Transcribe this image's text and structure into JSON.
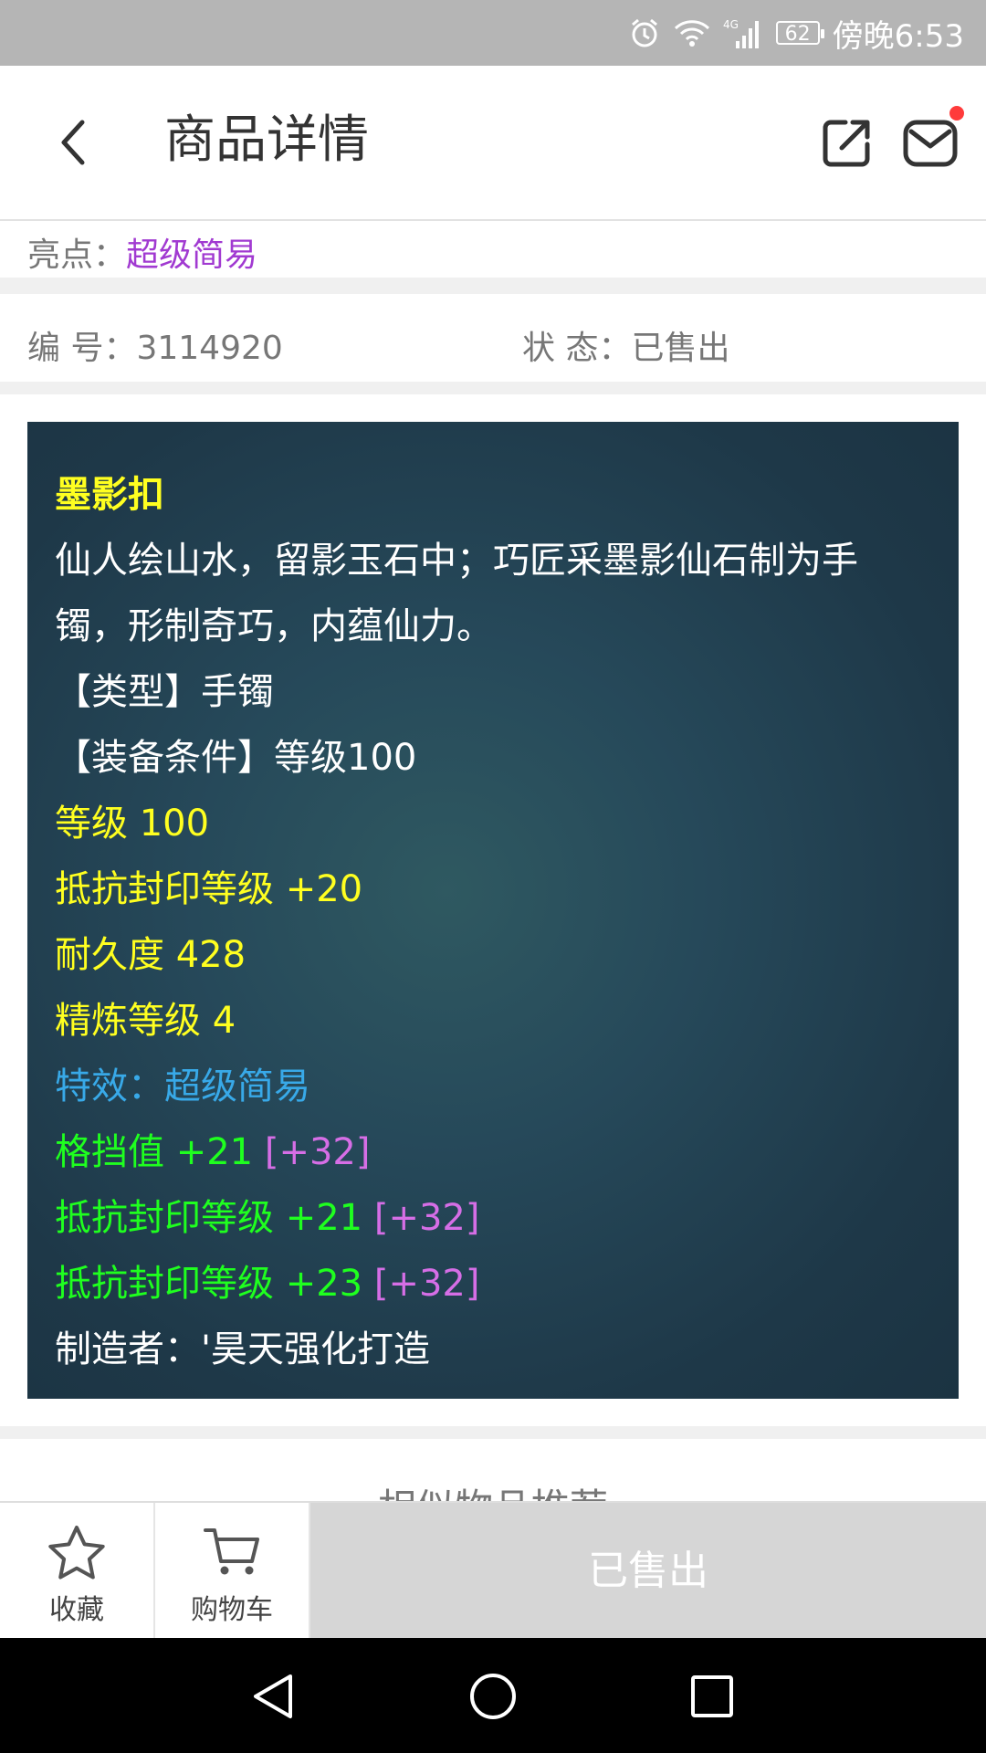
{
  "status_bar": {
    "battery": "62",
    "time": "傍晚6:53",
    "network": "4G"
  },
  "header": {
    "title": "商品详情"
  },
  "highlight": {
    "label": "亮点：",
    "value": "超级简易"
  },
  "info": {
    "id_label": "编 号：",
    "id_value": "3114920",
    "status_label": "状 态：",
    "status_value": "已售出"
  },
  "item": {
    "name": "墨影扣",
    "description_1": "仙人绘山水，留影玉石中；巧匠采墨影仙石制为手",
    "description_2": "镯，形制奇巧，内蕴仙力。",
    "type": "【类型】手镯",
    "requirement": "【装备条件】等级100",
    "level": "等级 100",
    "seal_resist": "抵抗封印等级 +20",
    "durability": "耐久度 428",
    "refine": "精炼等级 4",
    "effect": "特效：超级简易",
    "bonus_lines": [
      {
        "text": "格挡值 +21",
        "extra": "[+32]"
      },
      {
        "text": "抵抗封印等级 +21",
        "extra": "[+32]"
      },
      {
        "text": "抵抗封印等级 +23",
        "extra": "[+32]"
      }
    ],
    "maker": "制造者：'昊天强化打造"
  },
  "recommend": {
    "title": "· 相似物品推荐 ·"
  },
  "bottom_bar": {
    "favorite_label": "收藏",
    "cart_label": "购物车",
    "sold_label": "已售出"
  },
  "colors": {
    "title_yellow": "#ffff20",
    "effect_blue": "#38a9e8",
    "bonus_green": "#1fff1f",
    "extra_pink": "#d66ee6",
    "highlight_purple": "#a13ad1",
    "notification_red": "#ff3b3b"
  },
  "icons": [
    "alarm-icon",
    "wifi-icon",
    "signal-icon",
    "battery-icon",
    "back-icon",
    "share-icon",
    "mail-icon",
    "star-icon",
    "cart-icon",
    "nav-back-icon",
    "nav-home-icon",
    "nav-recents-icon"
  ]
}
